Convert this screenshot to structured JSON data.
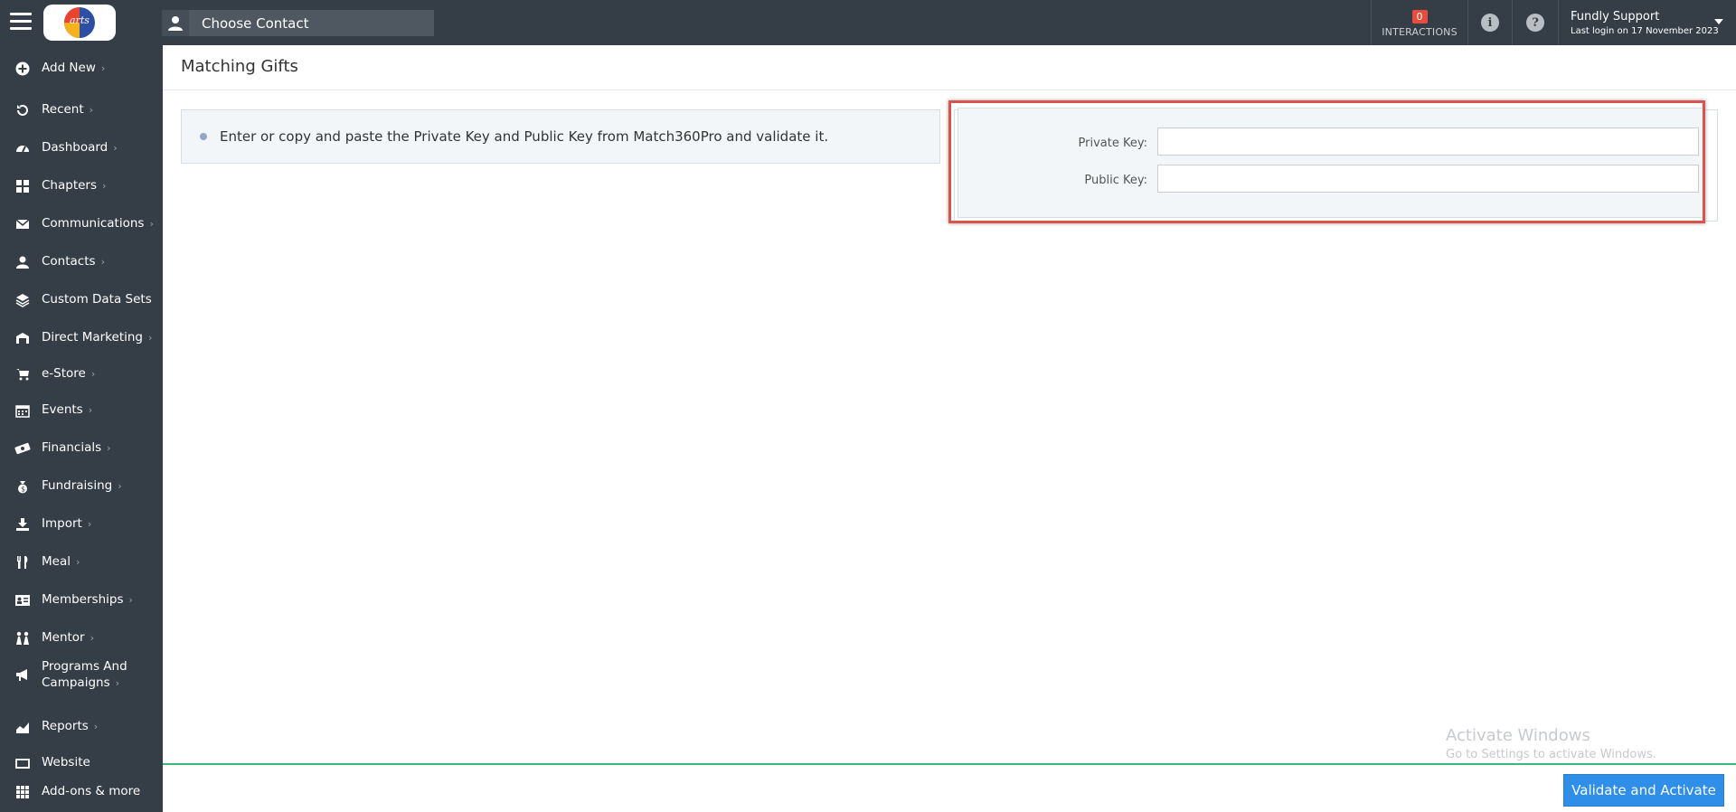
{
  "header": {
    "contact_placeholder": "Choose Contact",
    "interactions_count": "0",
    "interactions_label": "INTERACTIONS",
    "user_name": "Fundly Support",
    "last_login": "Last login on 17 November 2023"
  },
  "sidebar": {
    "items": [
      {
        "label": "Add New",
        "icon": "plus-circle-icon",
        "chevron": true
      },
      {
        "label": "Recent",
        "icon": "history-icon",
        "chevron": true
      },
      {
        "label": "Dashboard",
        "icon": "dashboard-gauge-icon",
        "chevron": true
      },
      {
        "label": "Chapters",
        "icon": "grid-icon",
        "chevron": true
      },
      {
        "label": "Communications",
        "icon": "envelope-icon",
        "chevron": true
      },
      {
        "label": "Contacts",
        "icon": "user-icon",
        "chevron": true
      },
      {
        "label": "Custom Data Sets",
        "icon": "layers-icon",
        "chevron": false
      },
      {
        "label": "Direct Marketing",
        "icon": "warehouse-icon",
        "chevron": true
      },
      {
        "label": "e-Store",
        "icon": "cart-icon",
        "chevron": true
      },
      {
        "label": "Events",
        "icon": "calendar-icon",
        "chevron": true
      },
      {
        "label": "Financials",
        "icon": "money-icon",
        "chevron": true
      },
      {
        "label": "Fundraising",
        "icon": "money-bag-icon",
        "chevron": true
      },
      {
        "label": "Import",
        "icon": "download-icon",
        "chevron": true
      },
      {
        "label": "Meal",
        "icon": "utensils-icon",
        "chevron": true
      },
      {
        "label": "Memberships",
        "icon": "id-card-icon",
        "chevron": true
      },
      {
        "label": "Mentor",
        "icon": "people-icon",
        "chevron": true
      },
      {
        "label": "Programs And Campaigns",
        "icon": "megaphone-icon",
        "chevron": true
      },
      {
        "label": "Reports",
        "icon": "chart-area-icon",
        "chevron": true
      },
      {
        "label": "Website",
        "icon": "monitor-icon",
        "chevron": false
      },
      {
        "label": "Add-ons & more",
        "icon": "apps-grid-icon",
        "chevron": false
      }
    ]
  },
  "main": {
    "title": "Matching Gifts",
    "info_text": "Enter or copy and paste the Private Key and Public Key from Match360Pro and validate it.",
    "private_key_label": "Private Key:",
    "private_key_value": "",
    "public_key_label": "Public Key:",
    "public_key_value": ""
  },
  "footer": {
    "validate_label": "Validate and Activate"
  },
  "watermark": {
    "line1": "Activate Windows",
    "line2": "Go to Settings to activate Windows."
  },
  "colors": {
    "topbar": "#353d47",
    "sidebar": "#353d47",
    "accent_button": "#2e8ee8",
    "highlight": "#d9534f",
    "footer_rule": "#3cb878",
    "badge": "#e74c3c"
  }
}
